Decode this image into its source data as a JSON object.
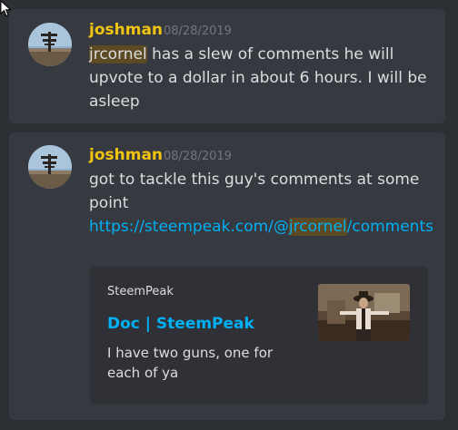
{
  "messages": [
    {
      "author": "joshman",
      "timestamp": "08/28/2019",
      "mention": "jrcornel",
      "text": " has a slew of comments he will upvote to a dollar in about 6 hours.  I will be asleep"
    },
    {
      "author": "joshman",
      "timestamp": "08/28/2019",
      "text": "got to tackle this guy's comments at some point",
      "link_prefix": "https://steempeak.com/@",
      "link_mention": "jrcornel",
      "link_suffix": "/comments",
      "embed": {
        "provider": "SteemPeak",
        "title": "Doc | SteemPeak",
        "description": "I have two guns, one for each of ya"
      }
    }
  ],
  "colors": {
    "author": "#f1c40f",
    "link": "#00b0f4",
    "mention_bg": "#5c4a24",
    "message_bg": "#36393f",
    "embed_bg": "#2f3136",
    "timestamp": "#72767d"
  }
}
